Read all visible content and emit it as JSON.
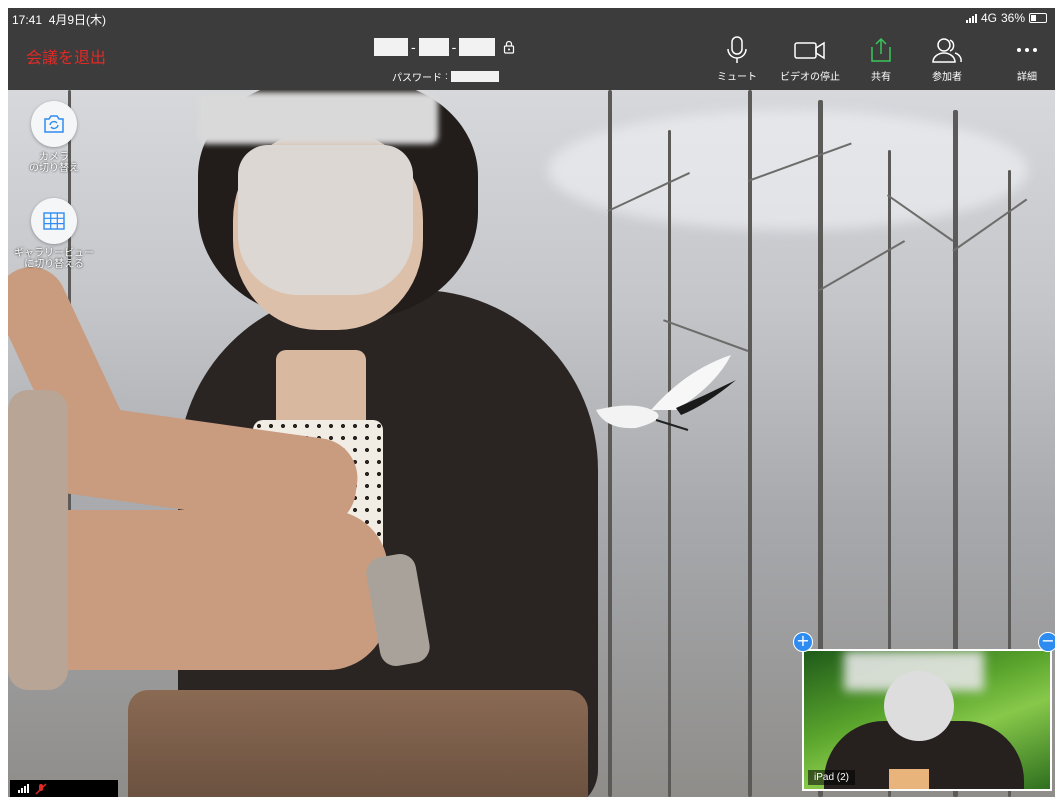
{
  "status_bar": {
    "time": "17:41",
    "date": "4月9日(木)",
    "network": "4G",
    "battery": "36%"
  },
  "toolbar": {
    "leave_label": "会議を退出",
    "password_label": "パスワード",
    "buttons": [
      {
        "id": "mute",
        "label": "ミュート",
        "icon": "microphone-icon"
      },
      {
        "id": "stop_video",
        "label": "ビデオの停止",
        "icon": "video-camera-icon"
      },
      {
        "id": "share",
        "label": "共有",
        "icon": "share-upload-icon"
      },
      {
        "id": "participants",
        "label": "参加者",
        "icon": "participants-icon"
      },
      {
        "id": "more",
        "label": "詳細",
        "icon": "more-dots-icon"
      }
    ]
  },
  "floating_controls": {
    "switch_camera_label": "カメラ\nの切り替え",
    "gallery_view_label": "ギャラリービュー\nに切り替える"
  },
  "thumbnail": {
    "label": "iPad (2)"
  },
  "colors": {
    "toolbar_bg": "#3c3c3c",
    "leave_red": "#e02a26",
    "share_green": "#3bc65a",
    "control_blue": "#2e8cf0"
  }
}
